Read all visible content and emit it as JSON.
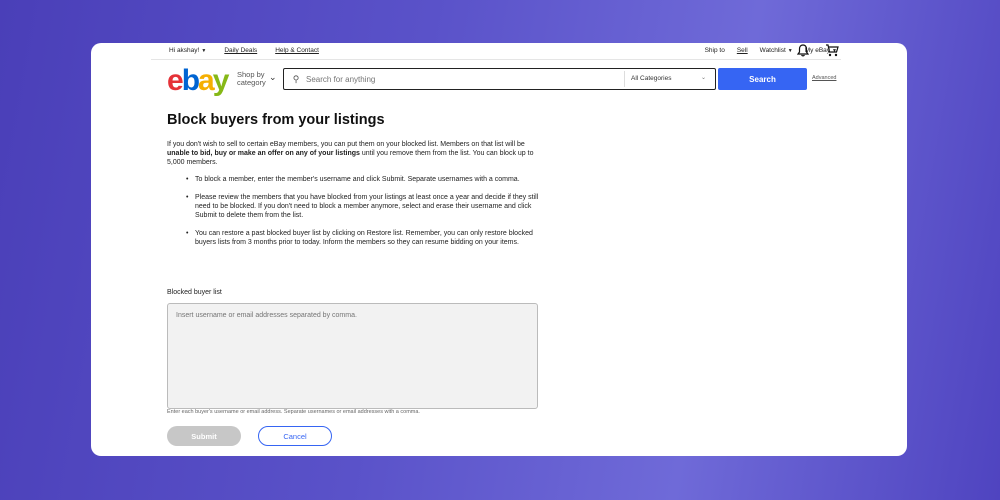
{
  "topbar": {
    "greeting": "Hi akshay!",
    "daily_deals": "Daily Deals",
    "help_contact": "Help & Contact",
    "ship_to": "Ship to",
    "sell": "Sell",
    "watchlist": "Watchlist",
    "my_ebay": "My eBay"
  },
  "header": {
    "logo": {
      "e": "e",
      "b": "b",
      "a": "a",
      "y": "y"
    },
    "shop_by_line1": "Shop by",
    "shop_by_line2": "category",
    "search_placeholder": "Search for anything",
    "category_selected": "All Categories",
    "search_button": "Search",
    "advanced": "Advanced"
  },
  "page": {
    "title": "Block buyers from your listings",
    "intro_1": "If you don't wish to sell to certain eBay members, you can put them on your blocked list. Members on that list will be ",
    "intro_bold": "unable to bid, buy or make an offer on any of your listings",
    "intro_2": " until you remove them from the list. You can block up to 5,000 members.",
    "bullets": [
      "To block a member, enter the member's username and click Submit. Separate usernames with a comma.",
      "Please review the members that you have blocked from your listings at least once a year and decide if they still need to be blocked. If you don't need to block a member anymore, select and erase their username and click Submit to delete them from the list.",
      "You can restore a past blocked buyer list by clicking on Restore list. Remember, you can only restore blocked buyers lists from 3 months prior to today. Inform the members so they can resume bidding on your items."
    ],
    "list_label": "Blocked buyer list",
    "textarea_placeholder": "Insert username or email addresses separated by comma.",
    "hint": "Enter each buyer's username or email address. Separate usernames or email addresses with a comma.",
    "submit": "Submit",
    "cancel": "Cancel"
  },
  "colors": {
    "accent": "#3665f3",
    "logo_e": "#e53238",
    "logo_b": "#0064d2",
    "logo_a": "#f5af02",
    "logo_y": "#86b817"
  }
}
